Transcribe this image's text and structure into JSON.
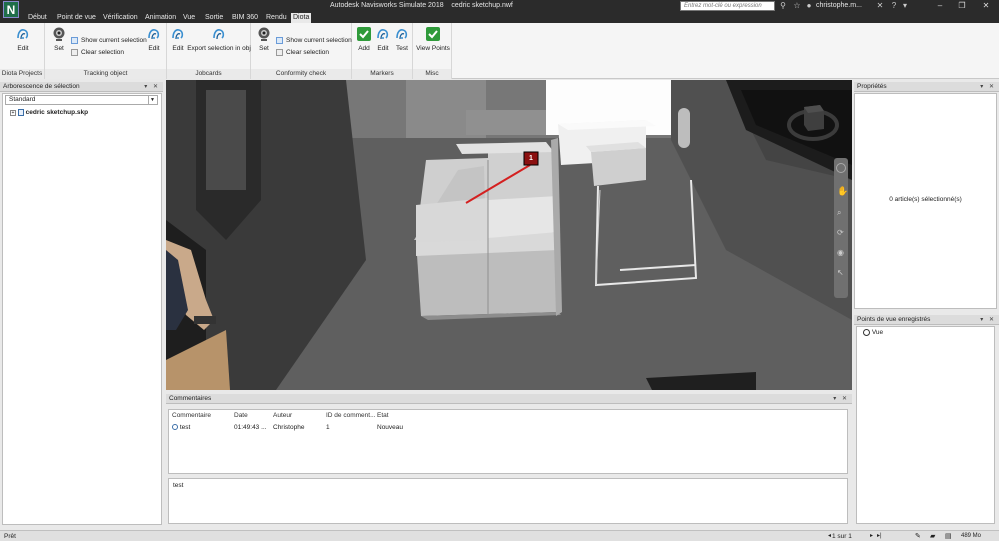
{
  "titlebar": {
    "app_title": "Autodesk Navisworks Simulate 2018",
    "file_name": "cedric sketchup.nwf",
    "search_placeholder": "Entrez mot-clé ou expression",
    "user_name": "christophe.m..."
  },
  "app_button": {
    "label": "N"
  },
  "menu": {
    "items": [
      "Début",
      "Point de vue",
      "Vérification",
      "Animation",
      "Vue",
      "Sortie",
      "BIM 360",
      "Rendu",
      "Diota"
    ],
    "active_index": 8
  },
  "ribbon": {
    "groups": {
      "diota_projects": {
        "label": "Diota Projects",
        "edit": "Edit"
      },
      "tracking_object": {
        "label": "Tracking object",
        "set": "Set",
        "show_current_selection": "Show current selection",
        "clear_selection": "Clear selection",
        "edit": "Edit"
      },
      "jobcards": {
        "label": "Jobcards",
        "edit": "Edit",
        "export_selection": "Export selection in obj"
      },
      "conformity_check": {
        "label": "Conformity check",
        "set": "Set",
        "show_current_selection": "Show current selection",
        "clear_selection": "Clear selection"
      },
      "markers": {
        "label": "Markers",
        "add": "Add",
        "edit": "Edit",
        "test": "Test"
      },
      "misc": {
        "label": "Misc",
        "view_points": "View Points"
      }
    }
  },
  "selection_tree": {
    "title": "Arborescence de sélection",
    "dropdown_value": "Standard",
    "root_item": "cedric sketchup.skp"
  },
  "properties": {
    "title": "Propriétés",
    "empty_text": "0 article(s) sélectionné(s)"
  },
  "saved_viewpoints": {
    "title": "Points de vue enregistrés",
    "items": [
      "Vue"
    ]
  },
  "comments": {
    "title": "Commentaires",
    "columns": [
      "Commentaire",
      "Date",
      "Auteur",
      "ID de comment...",
      "Etat"
    ],
    "rows": [
      {
        "comment": "test",
        "date": "01:49:43 ...",
        "author": "Christophe",
        "id": "1",
        "status": "Nouveau"
      }
    ],
    "detail_text": "test"
  },
  "statusbar": {
    "status": "Prêt",
    "page_info": "1 sur 1",
    "memory": "489 Mo"
  },
  "viewport": {
    "marker_label": "1"
  },
  "colors": {
    "title_bg": "#2b2b2b",
    "ribbon_bg": "#f5f5f5",
    "viewport_floor": "#5e5e5e",
    "marker_red": "#d42020"
  }
}
